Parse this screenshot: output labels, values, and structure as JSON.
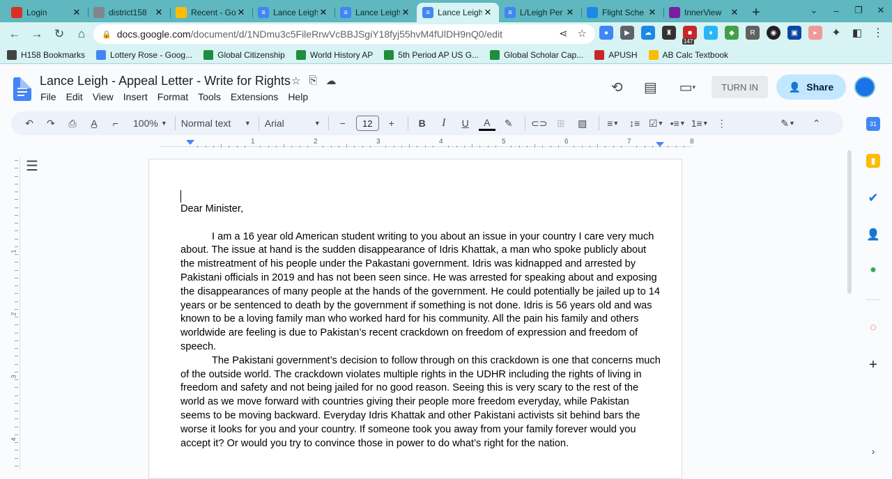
{
  "browser": {
    "tabs": [
      {
        "title": "Login",
        "active": false,
        "icon": "login-red-icon"
      },
      {
        "title": "district158",
        "active": false,
        "icon": "globe-icon"
      },
      {
        "title": "Recent - Go",
        "active": false,
        "icon": "drive-icon"
      },
      {
        "title": "Lance Leigh",
        "active": false,
        "icon": "docs-icon"
      },
      {
        "title": "Lance Leigh",
        "active": false,
        "icon": "docs-icon"
      },
      {
        "title": "Lance Leigh",
        "active": true,
        "icon": "docs-icon"
      },
      {
        "title": "L/Leigh Per",
        "active": false,
        "icon": "docs-icon"
      },
      {
        "title": "Flight Sche",
        "active": false,
        "icon": "flight-icon"
      },
      {
        "title": "InnerView",
        "active": false,
        "icon": "innerview-icon"
      }
    ],
    "new_tab": "+",
    "url_host": "docs.google.com",
    "url_path": "/document/d/1NDmu3c5FileRrwVcBBJSgiY18fyj55hvM4fUlDH9nQ0/edit",
    "extension_badge": "147",
    "bookmarks": [
      {
        "label": "H158 Bookmarks",
        "icon": "folder-icon"
      },
      {
        "label": "Lottery Rose - Goog...",
        "icon": "docs-icon"
      },
      {
        "label": "Global Citizenship",
        "icon": "classroom-icon"
      },
      {
        "label": "World History AP",
        "icon": "classroom-icon"
      },
      {
        "label": "5th Period AP US G...",
        "icon": "classroom-icon"
      },
      {
        "label": "Global Scholar Cap...",
        "icon": "classroom-icon"
      },
      {
        "label": "APUSH",
        "icon": "apush-icon"
      },
      {
        "label": "AB Calc Textbook",
        "icon": "drive-icon"
      }
    ]
  },
  "docs": {
    "title": "Lance Leigh - Appeal Letter - Write for Rights",
    "menu": [
      "File",
      "Edit",
      "View",
      "Insert",
      "Format",
      "Tools",
      "Extensions",
      "Help"
    ],
    "turn_in": "TURN IN",
    "share": "Share",
    "zoom": "100%",
    "style": "Normal text",
    "font": "Arial",
    "font_size": "12",
    "ruler_numbers": [
      "1",
      "2",
      "3",
      "4",
      "5",
      "6",
      "7",
      "8"
    ],
    "ruler_left_numbers": [
      "1",
      "2",
      "3",
      "4"
    ]
  },
  "letter": {
    "salutation": "Dear Minister,",
    "paragraph1": "I am a 16 year old American student writing to you about an issue in your country I care very much about. The issue at hand is the sudden disappearance of Idris Khattak, a man who spoke publicly about the mistreatment of his people under the Pakastani government. Idris was kidnapped and arrested by Pakistani officials in 2019 and has not been seen since. He was arrested for speaking about and exposing the disappearances of many people at the hands of the government. He could potentially be jailed up to 14 years or be sentenced to death by the government if something is not done. Idris is 56 years old and was known to be a loving family man who worked hard for his community. All the pain his family and others worldwide are feeling is due to Pakistan’s recent crackdown on freedom of expression and freedom of speech.",
    "paragraph2": "The Pakistani government’s decision to follow through on this crackdown is one that concerns much of the outside world. The crackdown violates multiple rights in the UDHR including the rights of living in freedom and safety and not being jailed for no good reason. Seeing this is very scary to the rest of the world as we move forward with countries giving their people more freedom everyday, while Pakistan seems to be moving backward. Everyday Idris Khattak and other Pakistani activists sit behind bars the worse it looks for you and your country. If someone took you away from your family forever would you accept it? Or would you try to convince those in power to do what’s right for the nation."
  }
}
